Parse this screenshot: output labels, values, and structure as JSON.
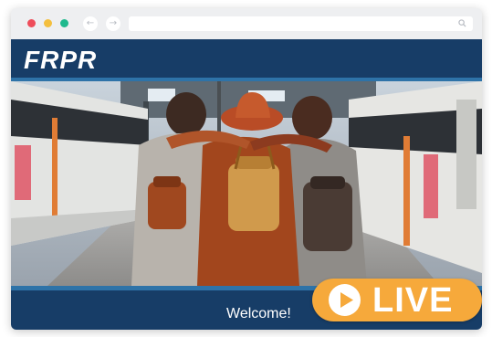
{
  "browser": {
    "back_icon": "back-arrow-icon",
    "forward_icon": "forward-arrow-icon",
    "back_glyph": "←",
    "forward_glyph": "→",
    "search_icon": "search-icon",
    "url": ""
  },
  "site": {
    "logo_text": "FRPR",
    "brand_color": "#173d67",
    "accent_color": "#2e73a8"
  },
  "hero": {
    "image_subject": "three travelers hugging on a train platform"
  },
  "footer": {
    "welcome_text": "Welcome!"
  },
  "live_badge": {
    "label": "LIVE",
    "icon": "play-icon",
    "color": "#f6a93b"
  }
}
